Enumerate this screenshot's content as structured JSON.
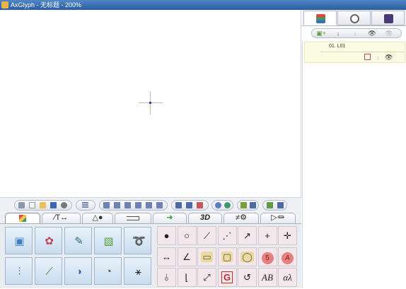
{
  "window": {
    "title": "AxGlyph - 无标题 - 200%"
  },
  "toolbar_groups": [
    {
      "name": "file-group",
      "buttons": [
        "menu",
        "new",
        "open",
        "save",
        "settings"
      ]
    },
    {
      "name": "style-group",
      "buttons": [
        "list-style"
      ]
    },
    {
      "name": "align-group",
      "buttons": [
        "align-left",
        "align-center",
        "align-right",
        "align-top",
        "align-middle",
        "align-bottom"
      ]
    },
    {
      "name": "distribute-group",
      "buttons": [
        "distribute-h",
        "distribute-v",
        "distribute-center"
      ]
    },
    {
      "name": "order-group",
      "buttons": [
        "order-1",
        "order-2"
      ]
    },
    {
      "name": "group-group",
      "buttons": [
        "group",
        "ungroup"
      ]
    },
    {
      "name": "extra-group",
      "buttons": [
        "extra"
      ]
    }
  ],
  "tabs": [
    {
      "id": "tab-color",
      "label": "",
      "icon": "palette-icon"
    },
    {
      "id": "tab-text",
      "label": "∕T↔",
      "icon": ""
    },
    {
      "id": "tab-shapes",
      "label": "△●",
      "icon": ""
    },
    {
      "id": "tab-connectors",
      "label": "",
      "icon": "connector-icon"
    },
    {
      "id": "tab-arrows",
      "label": "➜",
      "icon": ""
    },
    {
      "id": "tab-3d",
      "label": "3D",
      "icon": ""
    },
    {
      "id": "tab-symbols",
      "label": "≠⚙",
      "icon": ""
    },
    {
      "id": "tab-circuits",
      "label": "▷⏛",
      "icon": ""
    }
  ],
  "left_tiles": [
    {
      "name": "picture-tool",
      "glyph": "▣",
      "color": "#3f7fc0"
    },
    {
      "name": "shape-tool",
      "glyph": "✿",
      "color": "#c23f57"
    },
    {
      "name": "pen-tool",
      "glyph": "✎",
      "color": "#2d6f6a"
    },
    {
      "name": "box-tool",
      "glyph": "▧",
      "color": "#5c9b3e"
    },
    {
      "name": "paint-tool",
      "glyph": "➰",
      "color": "#3b3b3b"
    },
    {
      "name": "graph-tool",
      "glyph": "⫶",
      "color": "#6c5a9a"
    },
    {
      "name": "chart-tool",
      "glyph": "⟋",
      "color": "#3c7f3b"
    },
    {
      "name": "pie-tool",
      "glyph": "◑",
      "color": "#3e6fb5"
    },
    {
      "name": "gauge-tool",
      "glyph": "◔",
      "color": "#555555"
    },
    {
      "name": "runner-tool",
      "glyph": "⚹",
      "color": "#222222"
    }
  ],
  "right_tools": [
    {
      "name": "dot-filled",
      "glyph": "●",
      "style": ""
    },
    {
      "name": "dot-empty",
      "glyph": "○",
      "style": ""
    },
    {
      "name": "line",
      "glyph": "⟋",
      "style": ""
    },
    {
      "name": "dashed-line",
      "glyph": "⋰",
      "style": ""
    },
    {
      "name": "arrow-line",
      "glyph": "↗",
      "style": ""
    },
    {
      "name": "crosshair",
      "glyph": "+",
      "style": ""
    },
    {
      "name": "cross-arrow",
      "glyph": "✛",
      "style": ""
    },
    {
      "name": "dimension",
      "glyph": "↔",
      "style": ""
    },
    {
      "name": "angle",
      "glyph": "∠",
      "style": ""
    },
    {
      "name": "callout-rect",
      "glyph": "▭",
      "style": "callout"
    },
    {
      "name": "callout-round",
      "glyph": "▢",
      "style": "callout"
    },
    {
      "name": "callout-oval",
      "glyph": "◯",
      "style": "callout"
    },
    {
      "name": "number-badge",
      "glyph": "5",
      "style": "badge"
    },
    {
      "name": "letter-badge",
      "glyph": "A",
      "style": "badge-italic"
    },
    {
      "name": "mirror",
      "glyph": "⫰",
      "style": ""
    },
    {
      "name": "corner",
      "glyph": "⌊",
      "style": ""
    },
    {
      "name": "double-arrow",
      "glyph": "⤢",
      "style": ""
    },
    {
      "name": "g-frame",
      "glyph": "G",
      "style": "red-frame"
    },
    {
      "name": "rotate",
      "glyph": "↺",
      "style": ""
    },
    {
      "name": "italic-ab",
      "glyph": "AB",
      "style": "italic"
    },
    {
      "name": "greek",
      "glyph": "αλ",
      "style": "italic"
    }
  ],
  "sidebar": {
    "tabs": [
      {
        "name": "layers-tab",
        "icon": "layers-icon"
      },
      {
        "name": "palette-tab",
        "icon": "palette-icon"
      },
      {
        "name": "camera-tab",
        "icon": "camera-icon"
      }
    ],
    "toolbar": [
      {
        "name": "add-layer",
        "glyph": "▣+"
      },
      {
        "name": "delete-layer",
        "glyph": "↓"
      },
      {
        "name": "move-down",
        "glyph": "↓"
      },
      {
        "name": "show-layer",
        "glyph": "👁"
      },
      {
        "name": "hide-layer",
        "glyph": "👁"
      }
    ],
    "layers": [
      {
        "name": "01. L01"
      }
    ]
  },
  "colors": {
    "titlebar": "#2a5d9e",
    "tile_border": "#9fb6cc",
    "tool_cell": "#f4e7ec",
    "badge_red": "#e5807f",
    "layer_bg": "#fcfbe3",
    "accent_green": "#2e9b32"
  }
}
